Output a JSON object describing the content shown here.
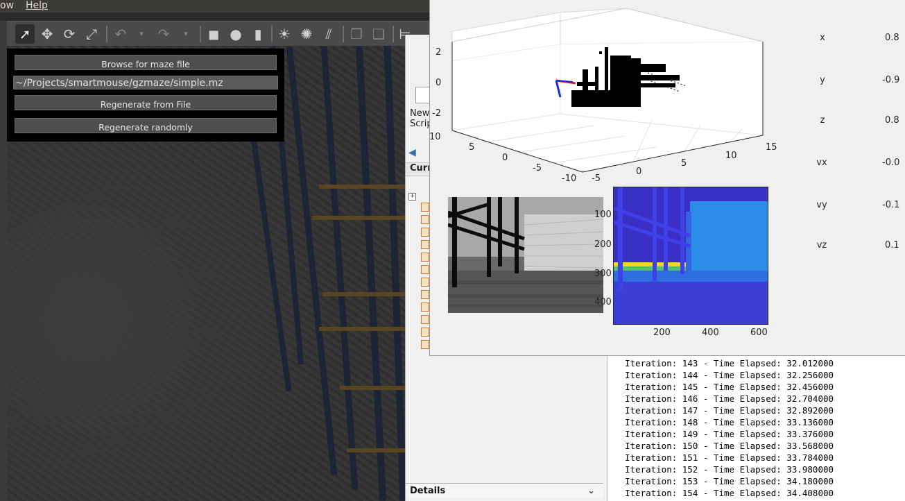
{
  "gazebo": {
    "menu": {
      "view": "ow",
      "help": "Help"
    },
    "toolbar_icons": [
      "select-arrow-icon",
      "translate-icon",
      "rotate-icon",
      "scale-icon",
      "undo-icon",
      "undo-dropdown-icon",
      "redo-icon",
      "redo-dropdown-icon",
      "box-icon",
      "sphere-icon",
      "cylinder-icon",
      "point-light-icon",
      "spot-light-icon",
      "directional-light-icon",
      "copy-icon",
      "paste-icon",
      "align-icon"
    ],
    "maze_panel": {
      "browse_label": "Browse for maze file",
      "path_value": "~/Projects/smartmouse/gzmaze/simple.mz",
      "regen_file_label": "Regenerate from File",
      "regen_random_label": "Regenerate randomly"
    }
  },
  "matlab": {
    "new_script": [
      "New",
      "Scrip"
    ],
    "current_folder": "Curr",
    "details": "Details"
  },
  "figure": {
    "plot3d": {
      "z_ticks": [
        "2",
        "0",
        "-2"
      ],
      "x_ticks": [
        "10",
        "5",
        "0",
        "-5",
        "-10"
      ],
      "y_ticks": [
        "-5",
        "0",
        "5",
        "10",
        "15"
      ]
    },
    "depth_axes": {
      "y_ticks": [
        "100",
        "200",
        "300",
        "400"
      ],
      "x_ticks": [
        "200",
        "400",
        "600"
      ]
    },
    "state": [
      {
        "label": "x",
        "value": "0.8"
      },
      {
        "label": "y",
        "value": "-0.9"
      },
      {
        "label": "z",
        "value": "0.8"
      },
      {
        "label": "vx",
        "value": "-0.0"
      },
      {
        "label": "vy",
        "value": "-0.1"
      },
      {
        "label": "vz",
        "value": "0.1"
      }
    ]
  },
  "console": {
    "lines": [
      "Iteration: 143 - Time Elapsed: 32.012000",
      "Iteration: 144 - Time Elapsed: 32.256000",
      "Iteration: 145 - Time Elapsed: 32.456000",
      "Iteration: 146 - Time Elapsed: 32.704000",
      "Iteration: 147 - Time Elapsed: 32.892000",
      "Iteration: 148 - Time Elapsed: 33.136000",
      "Iteration: 149 - Time Elapsed: 33.376000",
      "Iteration: 150 - Time Elapsed: 33.568000",
      "Iteration: 151 - Time Elapsed: 33.784000",
      "Iteration: 152 - Time Elapsed: 33.980000",
      "Iteration: 153 - Time Elapsed: 34.180000",
      "Iteration: 154 - Time Elapsed: 34.408000"
    ]
  }
}
